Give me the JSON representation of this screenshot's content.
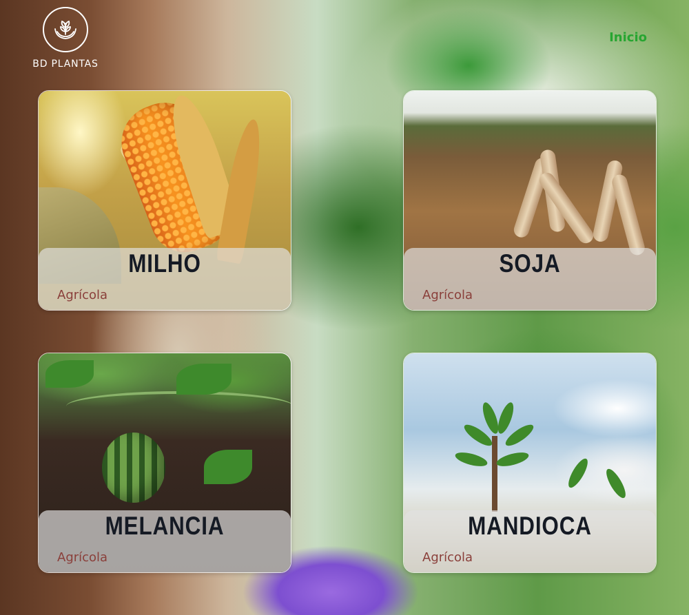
{
  "header": {
    "logo_text": "BD PLANTAS",
    "nav": [
      {
        "label": "Inicio"
      }
    ]
  },
  "cards": [
    {
      "title": "MILHO",
      "category": "Agrícola"
    },
    {
      "title": "SOJA",
      "category": "Agrícola"
    },
    {
      "title": "MELANCIA",
      "category": "Agrícola"
    },
    {
      "title": "MANDIOCA",
      "category": "Agrícola"
    }
  ],
  "colors": {
    "nav_link": "#27a531",
    "card_title": "#151a24",
    "card_category": "#8a3f3a",
    "logo": "#ffffff"
  },
  "icons": {
    "logo": "hands-holding-plant-icon"
  }
}
